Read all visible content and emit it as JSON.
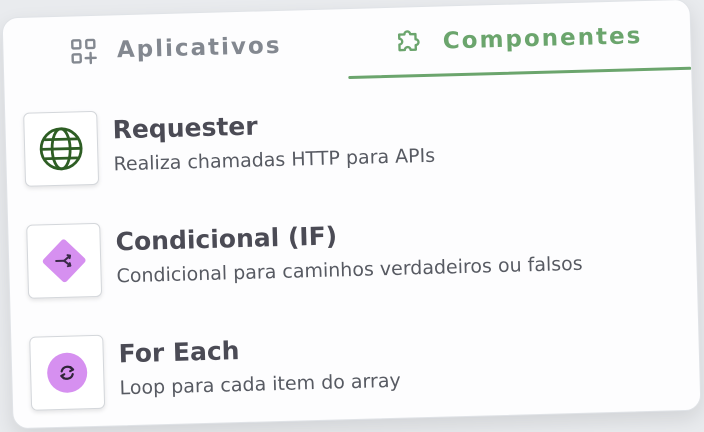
{
  "tabs": [
    {
      "label": "Aplicativos",
      "icon": "apps-add-icon",
      "active": false
    },
    {
      "label": "Componentes",
      "icon": "puzzle-icon",
      "active": true
    }
  ],
  "colors": {
    "accent": "#6ba56d",
    "inactive_tab": "#838890",
    "title_text": "#4b4b55",
    "desc_text": "#575a62",
    "globe_green": "#2e5e24",
    "purple": "#d690f0"
  },
  "components": [
    {
      "title": "Requester",
      "description": "Realiza chamadas HTTP para APIs",
      "icon": "globe-icon"
    },
    {
      "title": "Condicional (IF)",
      "description": "Condicional para caminhos verdadeiros ou falsos",
      "icon": "branch-diamond-icon"
    },
    {
      "title": "For Each",
      "description": "Loop para cada item do array",
      "icon": "loop-icon"
    }
  ]
}
